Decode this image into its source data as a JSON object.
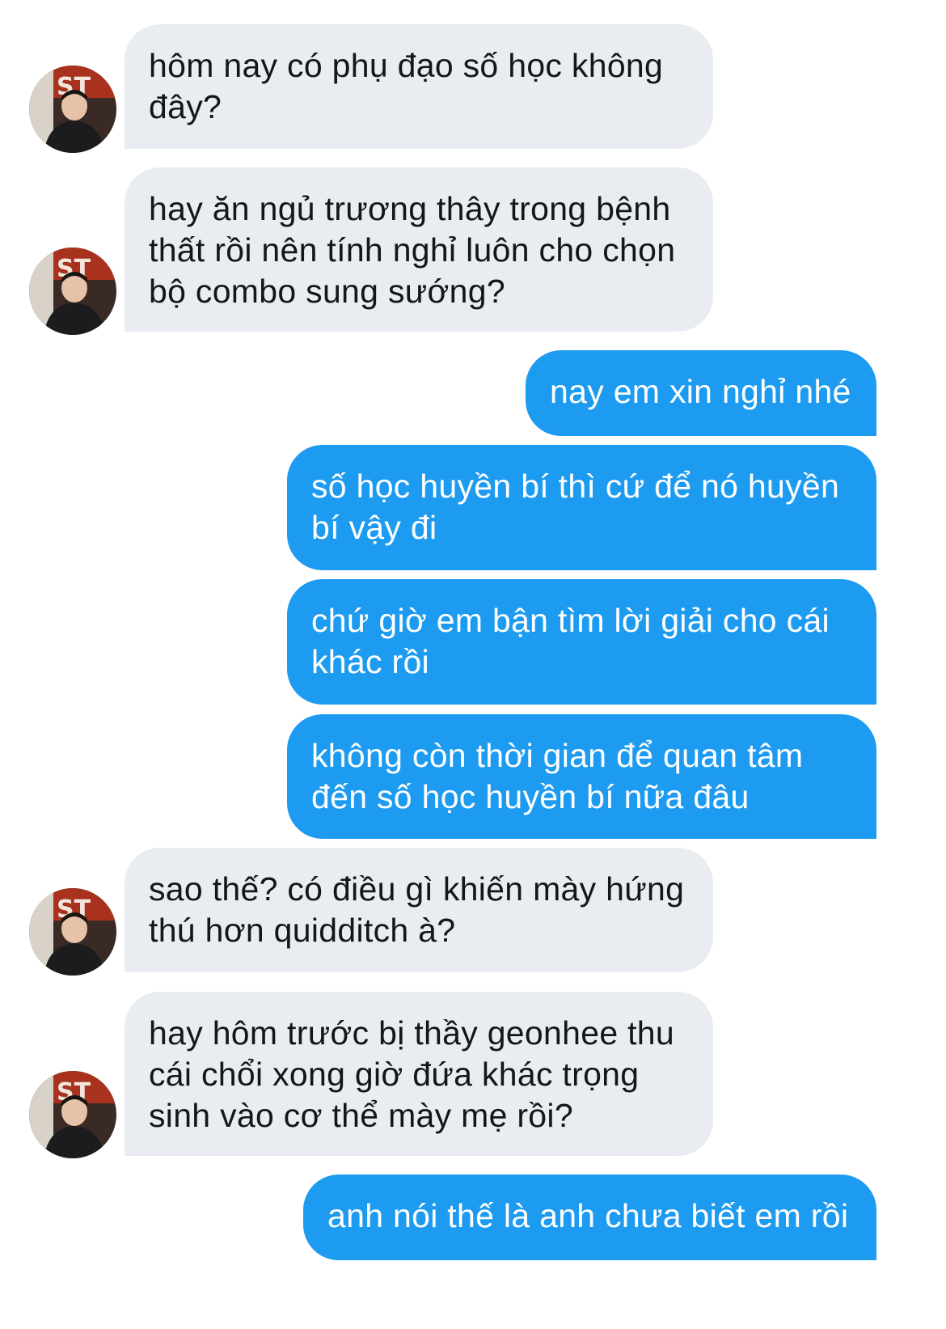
{
  "messages": [
    {
      "from": "them",
      "text": "hôm nay có phụ đạo số học không\nđây?"
    },
    {
      "from": "them",
      "text": "hay ăn ngủ trương thây trong bệnh\nthất rồi nên tính nghỉ luôn cho chọn\nbộ combo sung sướng?"
    },
    {
      "from": "me",
      "text": "nay em xin nghỉ nhé"
    },
    {
      "from": "me",
      "text": "số học huyền bí thì cứ để nó huyền\nbí vậy đi"
    },
    {
      "from": "me",
      "text": "chứ giờ em bận tìm lời giải cho cái\nkhác rồi"
    },
    {
      "from": "me",
      "text": "không còn thời gian để quan tâm\nđến số học huyền bí nữa đâu"
    },
    {
      "from": "them",
      "text": "sao thế? có điều gì khiến mày hứng\nthú hơn quidditch à?"
    },
    {
      "from": "them",
      "text": "hay hôm trước bị thầy geonhee thu\ncái chổi xong giờ đứa khác trọng\nsinh vào cơ thể mày mẹ rồi?"
    },
    {
      "from": "me",
      "text": "anh nói thế là anh chưa biết em rồi"
    }
  ],
  "colors": {
    "incoming_bubble": "#e9ecf0",
    "incoming_text": "#14171a",
    "outgoing_bubble": "#1d9bf0",
    "outgoing_text": "#ffffff"
  },
  "avatar": {
    "icon": "profile-photo-avatar-icon"
  }
}
